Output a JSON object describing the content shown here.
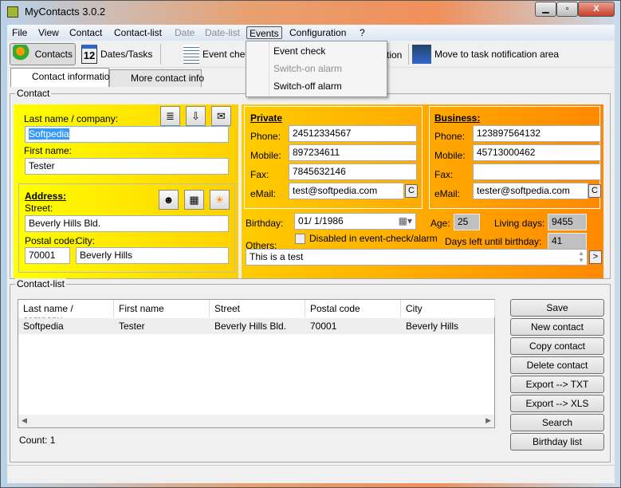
{
  "window": {
    "title": "MyContacts 3.0.2",
    "minimize": "▁",
    "maximize": "▫",
    "close": "X"
  },
  "menu": [
    "File",
    "View",
    "Contact",
    "Contact-list",
    "Date",
    "Date-list",
    "Events",
    "Configuration",
    "?"
  ],
  "events_menu": {
    "items": [
      {
        "label": "Event check",
        "enabled": true
      },
      {
        "label": "Switch-on alarm",
        "enabled": false
      },
      {
        "label": "Switch-off alarm",
        "enabled": true
      }
    ]
  },
  "toolbar": {
    "contacts": "Contacts",
    "dates": "Dates/Tasks",
    "calendar_day": "12",
    "event_check": "Event check",
    "hidden_fragment": "tion",
    "tray": "Move to task notification area"
  },
  "tabs": [
    "Contact information",
    "More contact info"
  ],
  "contact": {
    "group_label": "Contact",
    "last_name_label": "Last name / company:",
    "last_name": "Softpedia",
    "first_name_label": "First name:",
    "first_name": "Tester",
    "address_title": "Address:",
    "street_label": "Street:",
    "street": "Beverly Hills Bld.",
    "postal_label": "Postal code:",
    "postal": "70001",
    "city_label": "City:",
    "city": "Beverly Hills",
    "private": {
      "title": "Private",
      "phone_label": "Phone:",
      "phone": "24512334567",
      "mobile_label": "Mobile:",
      "mobile": "897234611",
      "fax_label": "Fax:",
      "fax": "7845632146",
      "email_label": "eMail:",
      "email": "test@softpedia.com",
      "copy": "C"
    },
    "business": {
      "title": "Business:",
      "phone_label": "Phone:",
      "phone": "123897564132",
      "mobile_label": "Mobile:",
      "mobile": "45713000462",
      "fax_label": "Fax:",
      "fax": "",
      "email_label": "eMail:",
      "email": "tester@softpedia.com",
      "copy": "C"
    },
    "birthday_label": "Birthday:",
    "birthday": "01/  1/1986",
    "age_label": "Age:",
    "age": "25",
    "living_days_label": "Living days:",
    "living_days": "9455",
    "days_left_label": "Days left until birthday:",
    "days_left": "41",
    "disabled_label": "Disabled in event-check/alarm",
    "disabled_checked": false,
    "others_label": "Others:",
    "others": "This is a test",
    "others_btn": ">"
  },
  "contact_list": {
    "group_label": "Contact-list",
    "columns": [
      "Last name / company",
      "First name",
      "Street",
      "Postal code",
      "City"
    ],
    "rows": [
      [
        "Softpedia",
        "Tester",
        "Beverly Hills Bld.",
        "70001",
        "Beverly Hills"
      ]
    ],
    "count": "Count: 1"
  },
  "buttons": [
    "Save",
    "New contact",
    "Copy contact",
    "Delete contact",
    "Export --> TXT",
    "Export --> XLS",
    "Search",
    "Birthday list"
  ]
}
